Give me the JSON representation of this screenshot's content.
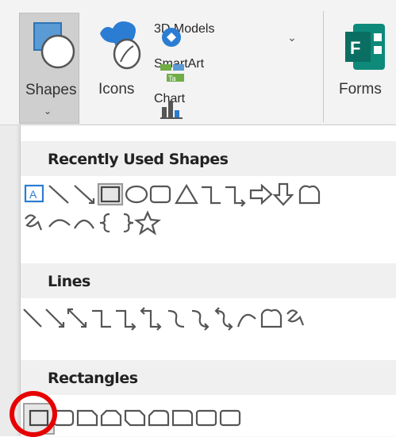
{
  "ribbon": {
    "shapes_label": "Shapes",
    "icons_label": "Icons",
    "models_label": "3D Models",
    "smartart_label": "SmartArt",
    "chart_label": "Chart",
    "forms_label": "Forms",
    "dropdown_caret": "⌄",
    "models_caret": "⌄"
  },
  "gallery": {
    "recent_header": "Recently Used Shapes",
    "lines_header": "Lines",
    "rect_header": "Rectangles",
    "recent_row1": [
      "text-box",
      "line",
      "line-arrow",
      "rectangle",
      "oval",
      "rounded-rectangle",
      "triangle",
      "elbow-connector",
      "elbow-arrow-connector",
      "right-arrow",
      "down-arrow",
      "freeform"
    ],
    "recent_row2": [
      "freeform-scribble",
      "arc",
      "curve",
      "left-brace",
      "right-brace",
      "star"
    ],
    "lines_row": [
      "line",
      "line-arrow",
      "line-double-arrow",
      "elbow-connector",
      "elbow-arrow",
      "elbow-double-arrow",
      "curved-connector",
      "curved-arrow",
      "curved-double-arrow",
      "curve",
      "freeform",
      "scribble"
    ],
    "rect_row": [
      "rectangle",
      "rounded-rectangle",
      "snip-single-corner",
      "snip-same-side",
      "snip-diagonal",
      "snip-round-single",
      "round-single-corner",
      "round-same-side",
      "round-diagonal"
    ]
  },
  "colors": {
    "annotation_circle": "#e60000",
    "accent_blue": "#2b7cd3"
  }
}
